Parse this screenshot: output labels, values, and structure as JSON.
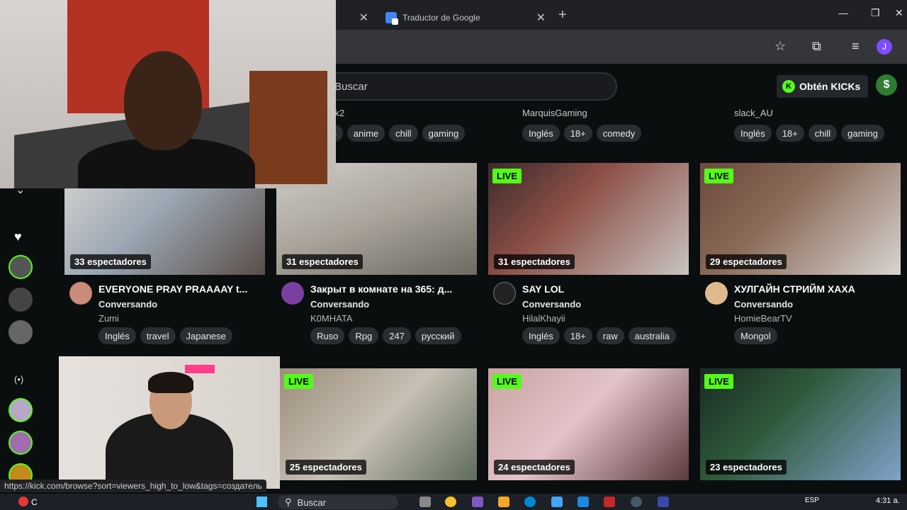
{
  "browser": {
    "tab1_close": "✕",
    "tab2_title": "Traductor de Google",
    "tab2_close": "✕",
    "new_tab": "+",
    "minimize": "—",
    "restore": "❐",
    "close": "✕",
    "profile_initial": "J"
  },
  "header": {
    "search_placeholder": "Buscar",
    "kicks_button": "Obtén KICKs",
    "kicks_logo_letter": "K",
    "avatar_letter": "$"
  },
  "top_row": [
    {
      "owner": "ck2",
      "tags": [
        "es",
        "anime",
        "chill",
        "gaming"
      ]
    },
    {
      "owner": "MarquisGaming",
      "tags": [
        "Inglés",
        "18+",
        "comedy"
      ]
    },
    {
      "owner": "slack_AU",
      "tags": [
        "Inglés",
        "18+",
        "chill",
        "gaming"
      ]
    }
  ],
  "cards_row1": [
    {
      "live": "",
      "viewers": "33 espectadores",
      "title": "EVERYONE PRAY PRAAAAY t...",
      "category": "Conversando",
      "user": "Zumi",
      "tags": [
        "Inglés",
        "travel",
        "Japanese"
      ]
    },
    {
      "live": "",
      "viewers": "31 espectadores",
      "title": "Закрыт в комнате на 365: д...",
      "category": "Conversando",
      "user": "K0MHATA",
      "tags": [
        "Ruso",
        "Rpg",
        "247",
        "русский"
      ]
    },
    {
      "live": "LIVE",
      "viewers": "31 espectadores",
      "title": "SAY LOL",
      "category": "Conversando",
      "user": "HilalKhayii",
      "tags": [
        "Inglés",
        "18+",
        "raw",
        "australia"
      ]
    },
    {
      "live": "LIVE",
      "viewers": "29 espectadores",
      "title": "ХУЛГАЙН СТРИЙМ ХАХА",
      "category": "Conversando",
      "user": "HomieBearTV",
      "tags": [
        "Mongol"
      ]
    }
  ],
  "cards_row2": [
    {
      "live": "LIVE",
      "viewers": "25 espectadores"
    },
    {
      "live": "LIVE",
      "viewers": "24 espectadores"
    },
    {
      "live": "LIVE",
      "viewers": "23 espectadores"
    }
  ],
  "sidebar": {
    "heart": "♥",
    "chevron": "⌄",
    "radio": "(•)"
  },
  "status_url": "https://kick.com/browse?sort=viewers_high_to_low&tags=создатель",
  "taskbar": {
    "weather_label": "C",
    "search": "Buscar",
    "lang": "ESP",
    "time": "4:31 a."
  },
  "colors": {
    "accent": "#53fc18",
    "background": "#0b0e0f",
    "tag_bg": "#2a2e33"
  }
}
